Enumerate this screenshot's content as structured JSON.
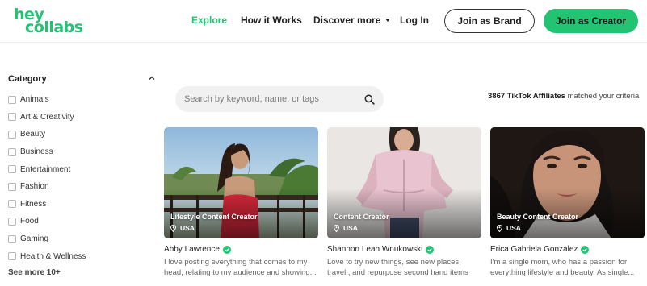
{
  "brand": {
    "logo_line1": "hey",
    "logo_line2": "collabs",
    "accent": "#22c373"
  },
  "nav": {
    "explore": "Explore",
    "how_it_works": "How it Works",
    "discover_more": "Discover more",
    "login": "Log In",
    "join_brand": "Join as Brand",
    "join_creator": "Join as Creator"
  },
  "sidebar": {
    "title": "Category",
    "items": [
      {
        "label": "Animals"
      },
      {
        "label": "Art & Creativity"
      },
      {
        "label": "Beauty"
      },
      {
        "label": "Business"
      },
      {
        "label": "Entertainment"
      },
      {
        "label": "Fashion"
      },
      {
        "label": "Fitness"
      },
      {
        "label": "Food"
      },
      {
        "label": "Gaming"
      },
      {
        "label": "Health & Wellness"
      }
    ],
    "see_more": "See more 10+"
  },
  "search": {
    "placeholder": "Search by keyword, name, or tags"
  },
  "results": {
    "count": "3867 TikTok Affiliates",
    "suffix": "matched your criteria"
  },
  "creators": [
    {
      "tag": "Lifestyle Content Creator",
      "location": "USA",
      "name": "Abby Lawrence",
      "bio": "I love posting everything that comes to my head, relating to my audience and showing..."
    },
    {
      "tag": "Content Creator",
      "location": "USA",
      "name": "Shannon Leah Wnukowski",
      "bio": "Love to try new things, see new places, travel , and repurpose second hand items"
    },
    {
      "tag": "Beauty Content Creator",
      "location": "USA",
      "name": "Erica Gabriela Gonzalez",
      "bio": "I'm a single mom, who has a passion for everything lifestyle and beauty. As single..."
    }
  ]
}
